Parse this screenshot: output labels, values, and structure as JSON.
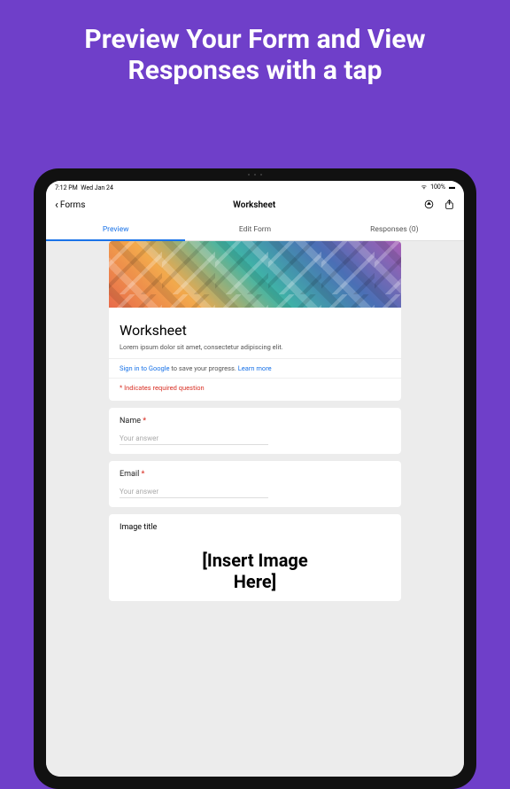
{
  "hero": "Preview Your Form and View Responses with a tap",
  "statusbar": {
    "time": "7:12 PM",
    "date": "Wed Jan 24",
    "wifi": "᯾",
    "battery": "100%"
  },
  "nav": {
    "back_label": "Forms",
    "title": "Worksheet"
  },
  "tabs": {
    "preview": "Preview",
    "edit": "Edit Form",
    "responses": "Responses (0)"
  },
  "form": {
    "title": "Worksheet",
    "description": "Lorem ipsum dolor sit amet, consectetur adipiscing elit.",
    "signin_pre": "Sign in to Google",
    "signin_mid": " to save your progress. ",
    "signin_link": "Learn more",
    "required_note": "* Indicates required question",
    "q1_label": "Name",
    "q2_label": "Email",
    "answer_placeholder": "Your answer",
    "img_title": "Image title",
    "img_placeholder_l1": "[Insert Image",
    "img_placeholder_l2": "Here]"
  }
}
